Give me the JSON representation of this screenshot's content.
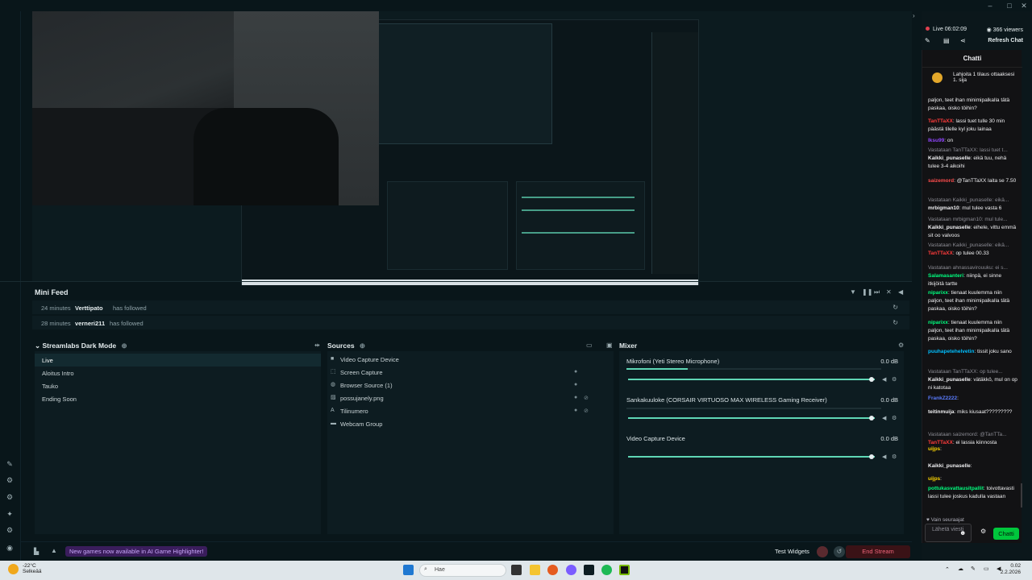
{
  "stream": {
    "live_time": "Live 06:02:09",
    "viewers": "366 viewers",
    "refresh_label": "Refresh Chat"
  },
  "minifeed": {
    "title": "Mini Feed",
    "events": [
      {
        "time": "24 minutes",
        "name": "Verttipato",
        "action": "has followed"
      },
      {
        "time": "28 minutes",
        "name": "verneri211",
        "action": "has followed"
      }
    ]
  },
  "scenes": {
    "title": "Streamlabs Dark Mode",
    "items": [
      "Live",
      "Aloitus Intro",
      "Tauko",
      "Ending Soon"
    ],
    "active": "Live"
  },
  "sources": {
    "title": "Sources",
    "items": [
      "Video Capture Device",
      "Screen Capture",
      "Browser Source (1)",
      "possujanely.png",
      "Tilinumero",
      "Webcam Group"
    ]
  },
  "mixer": {
    "title": "Mixer",
    "channels": [
      {
        "name": "Mikrofoni (Yeti Stereo Microphone)",
        "db": "0.0 dB",
        "level": 0.24
      },
      {
        "name": "Sankakuuloke (CORSAIR VIRTUOSO MAX WIRELESS Gaming Receiver)",
        "db": "0.0 dB",
        "level": 0.0
      },
      {
        "name": "Video Capture Device",
        "db": "0.0 dB",
        "level": 0.0
      }
    ]
  },
  "bottom": {
    "banner": "New games now available in AI Game Highlighter!",
    "test_widgets": "Test Widgets",
    "end_stream": "End Stream"
  },
  "chat": {
    "title": "Chatti",
    "pinned": "Lahjoita 1 tilaus ottaaksesi 1. sija",
    "messages": [
      {
        "reply": "",
        "user": "",
        "color": "#efeff1",
        "text": "paljon, teet ihan minimipalkalla tätä paskaa, oisko töihin?"
      },
      {
        "reply": "",
        "user": "TanTTaXX",
        "color": "#ff3b3b",
        "text": ": lassi tuet tulle 30 min päästä tilelle kyl joku lainaa"
      },
      {
        "reply": "",
        "user": "Iksu99",
        "color": "#9146ff",
        "text": ": on"
      },
      {
        "reply": "Vastataan TanTTaXX: lassi tuet t...",
        "user": "Kaikki_punaselle",
        "color": "#efeff1",
        "text": ": eikä tuu, nehä tulee 3-4 aikoihi"
      },
      {
        "reply": "",
        "user": "saizemord",
        "color": "#ff4d4d",
        "text": ": @TanTTaXX laita se 7.50"
      },
      {
        "reply": "Vastataan Kaikki_punaselle: eikä...",
        "user": "mrbigman10",
        "color": "#efeff1",
        "text": ": mul tulee vasta 6"
      },
      {
        "reply": "Vastataan mrbigman10: mul tule...",
        "user": "Kaikki_punaselle",
        "color": "#efeff1",
        "text": ": eihele, vittu emmä sit oo valvoos"
      },
      {
        "reply": "Vastataan Kaikki_punaselle: eikä...",
        "user": "TanTTaXX",
        "color": "#ff3b3b",
        "text": ": op tulee 00.33"
      },
      {
        "reply": "Vastataan ahnassavirouuku: ei s...",
        "user": "Salamasanteri",
        "color": "#00ff7f",
        "text": ": niinpä, ei sinne itkijöitä tartte"
      },
      {
        "reply": "",
        "user": "niparixx",
        "color": "#00ff7f",
        "text": ": tienaat kuulemma niin paljon, teet ihan minimipalkalla tätä paskaa, oisko töihin?"
      },
      {
        "reply": "",
        "user": "niparixx",
        "color": "#00ff7f",
        "text": ": tienaat kuulemma niin paljon, teet ihan minimipalkalla tätä paskaa, oisko töihin?"
      },
      {
        "reply": "",
        "user": "puuhapetehelvetin",
        "color": "#00bfff",
        "text": ": tissit joku sano"
      },
      {
        "reply": "Vastataan TanTTaXX: op tulee...",
        "user": "Kaikki_punaselle",
        "color": "#efeff1",
        "text": ": vätäkkö, mul on op ni katotaa"
      },
      {
        "reply": "",
        "user": "FrankZ2222",
        "color": "#5a7cff",
        "text": ":"
      },
      {
        "reply": "",
        "user": "teitinmuija",
        "color": "#efeff1",
        "text": ": miks kiusaat?????????"
      },
      {
        "reply": "Vastataan saizemord: @TanTTa...",
        "user": "TanTTaXX",
        "color": "#ff3b3b",
        "text": ": ei lassia kiinnosta"
      },
      {
        "reply": "",
        "user": "uijps",
        "color": "#ffd700",
        "text": ":"
      },
      {
        "reply": "",
        "user": "Kaikki_punaselle",
        "color": "#efeff1",
        "text": ":"
      },
      {
        "reply": "",
        "user": "uijps",
        "color": "#ffd700",
        "text": ":"
      },
      {
        "reply": "",
        "user": "pottukasvattausitpallit",
        "color": "#00ff7f",
        "text": ": toivottavasti lassi tulee joskus kadulla vastaan"
      }
    ],
    "followers_only": "Vain seuraajat",
    "input_placeholder": "Lähetä viesti",
    "send_label": "Chatti"
  },
  "taskbar": {
    "temperature": "-22°C",
    "weather": "Selkeää",
    "search_placeholder": "Hae",
    "time": "0.02",
    "date": "2.2.2026"
  },
  "colors": {
    "accent": "#5fd6b5",
    "end_stream": "#f0657a",
    "chat_button": "#00c73c",
    "live_dot": "#e0404f"
  }
}
